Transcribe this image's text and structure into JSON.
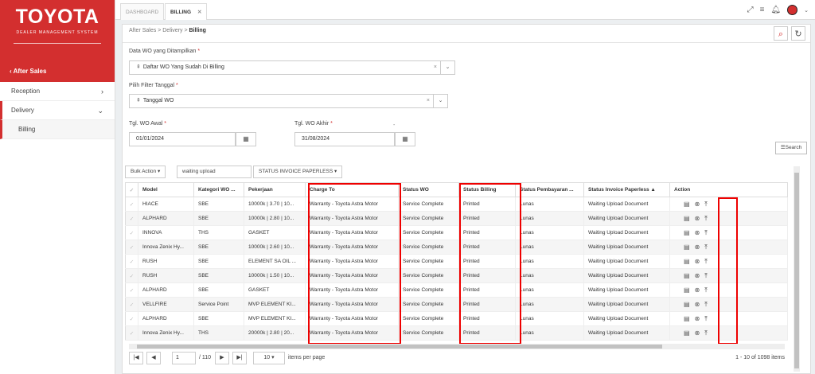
{
  "brand": {
    "logo": "TOYOTA",
    "subtitle": "DEALER MANAGEMENT SYSTEM"
  },
  "sidebar": {
    "active": "After Sales",
    "items": [
      {
        "label": "Reception",
        "chevron": "›"
      },
      {
        "label": "Delivery",
        "chevron": "⌄"
      },
      {
        "label": "Billing",
        "chevron": ""
      }
    ]
  },
  "tabs": [
    {
      "label": "DASHBOARD"
    },
    {
      "label": "BILLING",
      "close": "✕"
    }
  ],
  "breadcrumb": {
    "a": "After Sales",
    "b": "Delivery",
    "c": "Billing",
    "sep": ">"
  },
  "form": {
    "data_wo_label": "Data WO yang Ditampilkan",
    "data_wo_value": "Daftar WO Yang Sudah Di Billing",
    "filter_label": "Pilih Filter Tanggal",
    "filter_value": "Tanggal WO",
    "awal_label": "Tgl. WO Awal",
    "awal_value": "01/01/2024",
    "akhir_label": "Tgl. WO Akhir",
    "akhir_value": "31/08/2024",
    "req": "*",
    "dash": "-",
    "search_label": "Search"
  },
  "actionbar": {
    "bulk": "Bulk Action ▾",
    "filter": "waiting upload",
    "status": "STATUS INVOICE PAPERLESS ▾"
  },
  "table": {
    "headers": [
      "Model",
      "Kategori WO ...",
      "Pekerjaan",
      "Charge To",
      "Status WO",
      "Status Billing",
      "Status Pembayaran ...",
      "Status Invoice Paperless ▲",
      "Action"
    ],
    "rows": [
      [
        "HIACE",
        "SBE",
        "10000k | 3.70 | 10...",
        "Warranty - Toyota Astra Motor",
        "Service Complete",
        "Printed",
        "Lunas",
        "Waiting Upload Document"
      ],
      [
        "ALPHARD",
        "SBE",
        "10000k | 2.80 | 10...",
        "Warranty - Toyota Astra Motor",
        "Service Complete",
        "Printed",
        "Lunas",
        "Waiting Upload Document"
      ],
      [
        "INNOVA",
        "THS",
        "GASKET",
        "Warranty - Toyota Astra Motor",
        "Service Complete",
        "Printed",
        "Lunas",
        "Waiting Upload Document"
      ],
      [
        "Innova Zenix Hy...",
        "SBE",
        "10000k | 2.60 | 10...",
        "Warranty - Toyota Astra Motor",
        "Service Complete",
        "Printed",
        "Lunas",
        "Waiting Upload Document"
      ],
      [
        "RUSH",
        "SBE",
        "ELEMENT SA OIL ...",
        "Warranty - Toyota Astra Motor",
        "Service Complete",
        "Printed",
        "Lunas",
        "Waiting Upload Document"
      ],
      [
        "RUSH",
        "SBE",
        "10000k | 1.50 | 10...",
        "Warranty - Toyota Astra Motor",
        "Service Complete",
        "Printed",
        "Lunas",
        "Waiting Upload Document"
      ],
      [
        "ALPHARD",
        "SBE",
        "GASKET",
        "Warranty - Toyota Astra Motor",
        "Service Complete",
        "Printed",
        "Lunas",
        "Waiting Upload Document"
      ],
      [
        "VELLFIRE",
        "Service Point",
        "MVP ELEMENT KI...",
        "Warranty - Toyota Astra Motor",
        "Service Complete",
        "Printed",
        "Lunas",
        "Waiting Upload Document"
      ],
      [
        "ALPHARD",
        "SBE",
        "MVP ELEMENT KI...",
        "Warranty - Toyota Astra Motor",
        "Service Complete",
        "Printed",
        "Lunas",
        "Waiting Upload Document"
      ],
      [
        "Innova Zenix Hy...",
        "THS",
        "20000k | 2.80 | 20...",
        "Warranty - Toyota Astra Motor",
        "Service Complete",
        "Printed",
        "Lunas",
        "Waiting Upload Document"
      ]
    ]
  },
  "pager": {
    "first": "|◀",
    "prev": "◀",
    "page": "1",
    "of": "/ 110",
    "next": "▶",
    "last": "▶|",
    "per_page": "10 ▾",
    "per_page_label": "items per page",
    "summary": "1 - 10 of 1098 items"
  }
}
